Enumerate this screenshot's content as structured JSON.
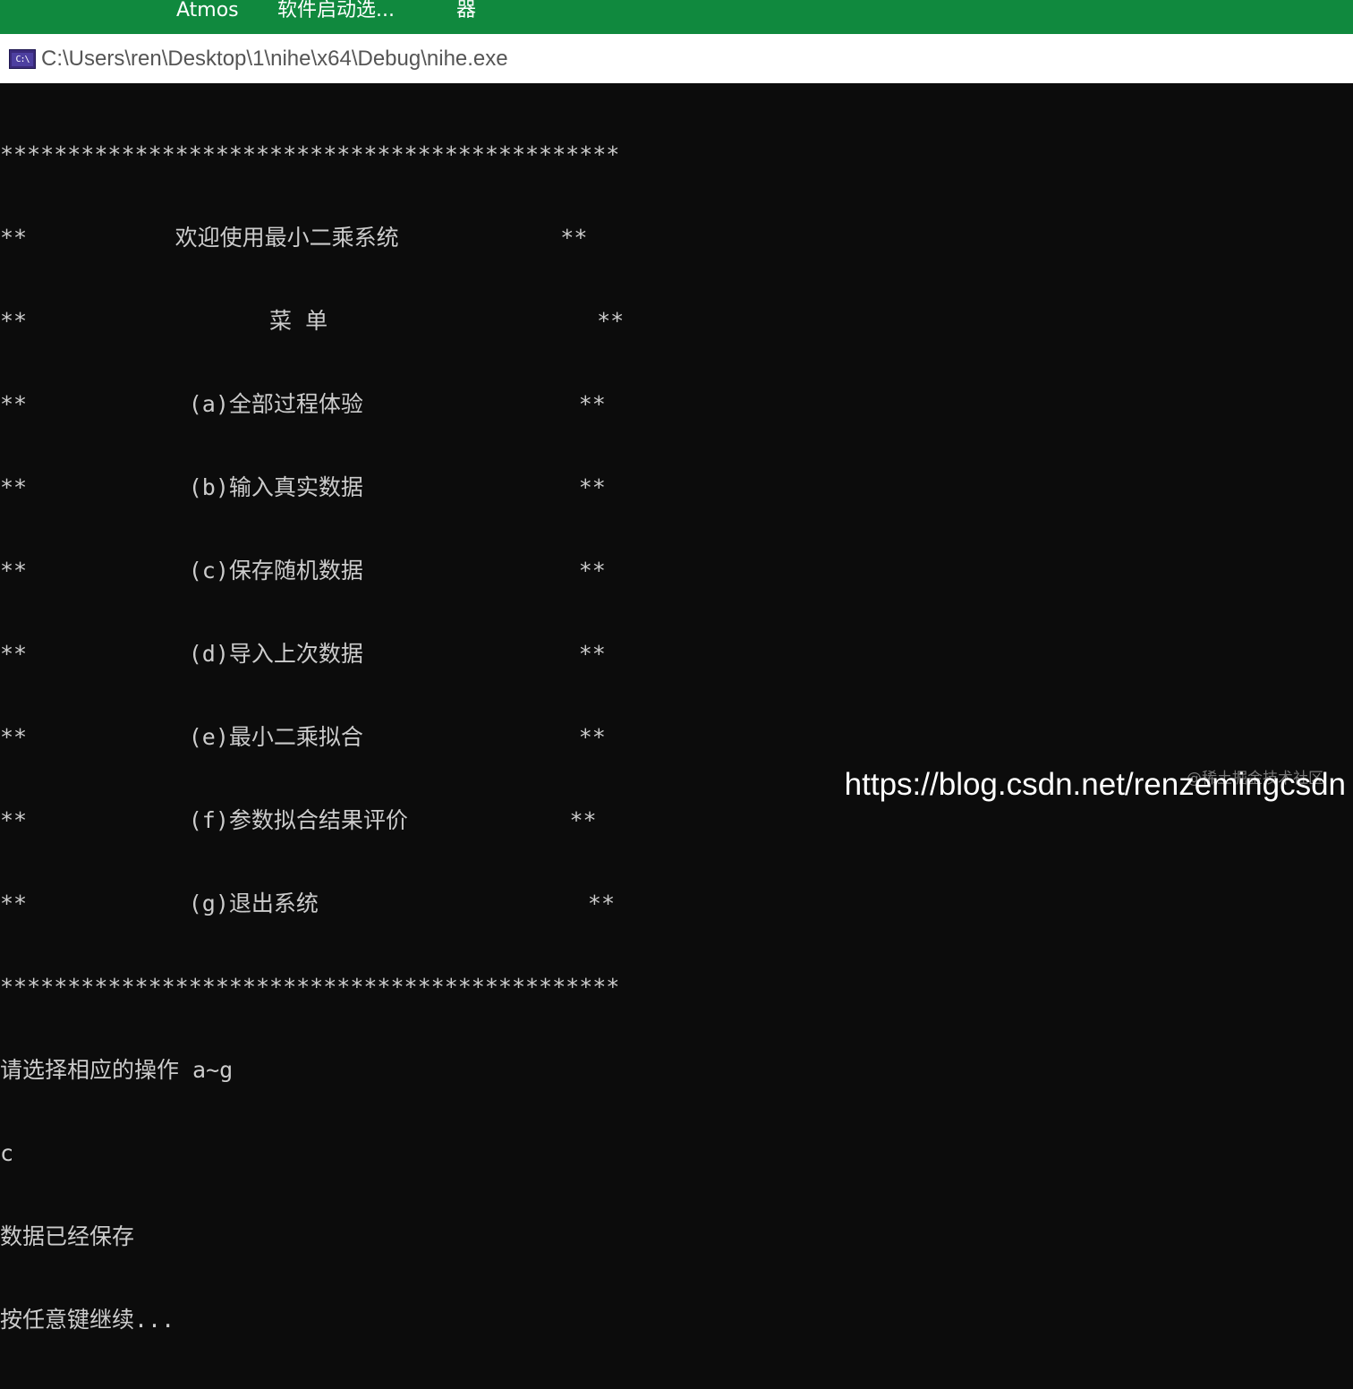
{
  "taskbar": {
    "items": [
      {
        "label": "Atmos"
      },
      {
        "label": "软件启动选..."
      },
      {
        "label": "器"
      }
    ],
    "color": "#10893e"
  },
  "window": {
    "title": "C:\\Users\\ren\\Desktop\\1\\nihe\\x64\\Debug\\nihe.exe",
    "icon": "console-icon",
    "icon_text": "C:\\"
  },
  "console": {
    "lines": [
      "**********************************************",
      "**           欢迎使用最小二乘系统            **",
      "**                  菜 单                    **",
      "**            (a)全部过程体验                **",
      "**            (b)输入真实数据                **",
      "**            (c)保存随机数据                **",
      "**            (d)导入上次数据                **",
      "**            (e)最小二乘拟合                **",
      "**            (f)参数拟合结果评价            **",
      "**            (g)退出系统                    **",
      "**********************************************",
      "请选择相应的操作 a~g",
      "c",
      "数据已经保存",
      "按任意键继续..."
    ],
    "background": "#0c0c0c",
    "foreground": "#cccccc"
  },
  "overlay": {
    "watermark": "@稀土掘金技术社区",
    "url": "https://blog.csdn.net/renzemingcsdn"
  }
}
